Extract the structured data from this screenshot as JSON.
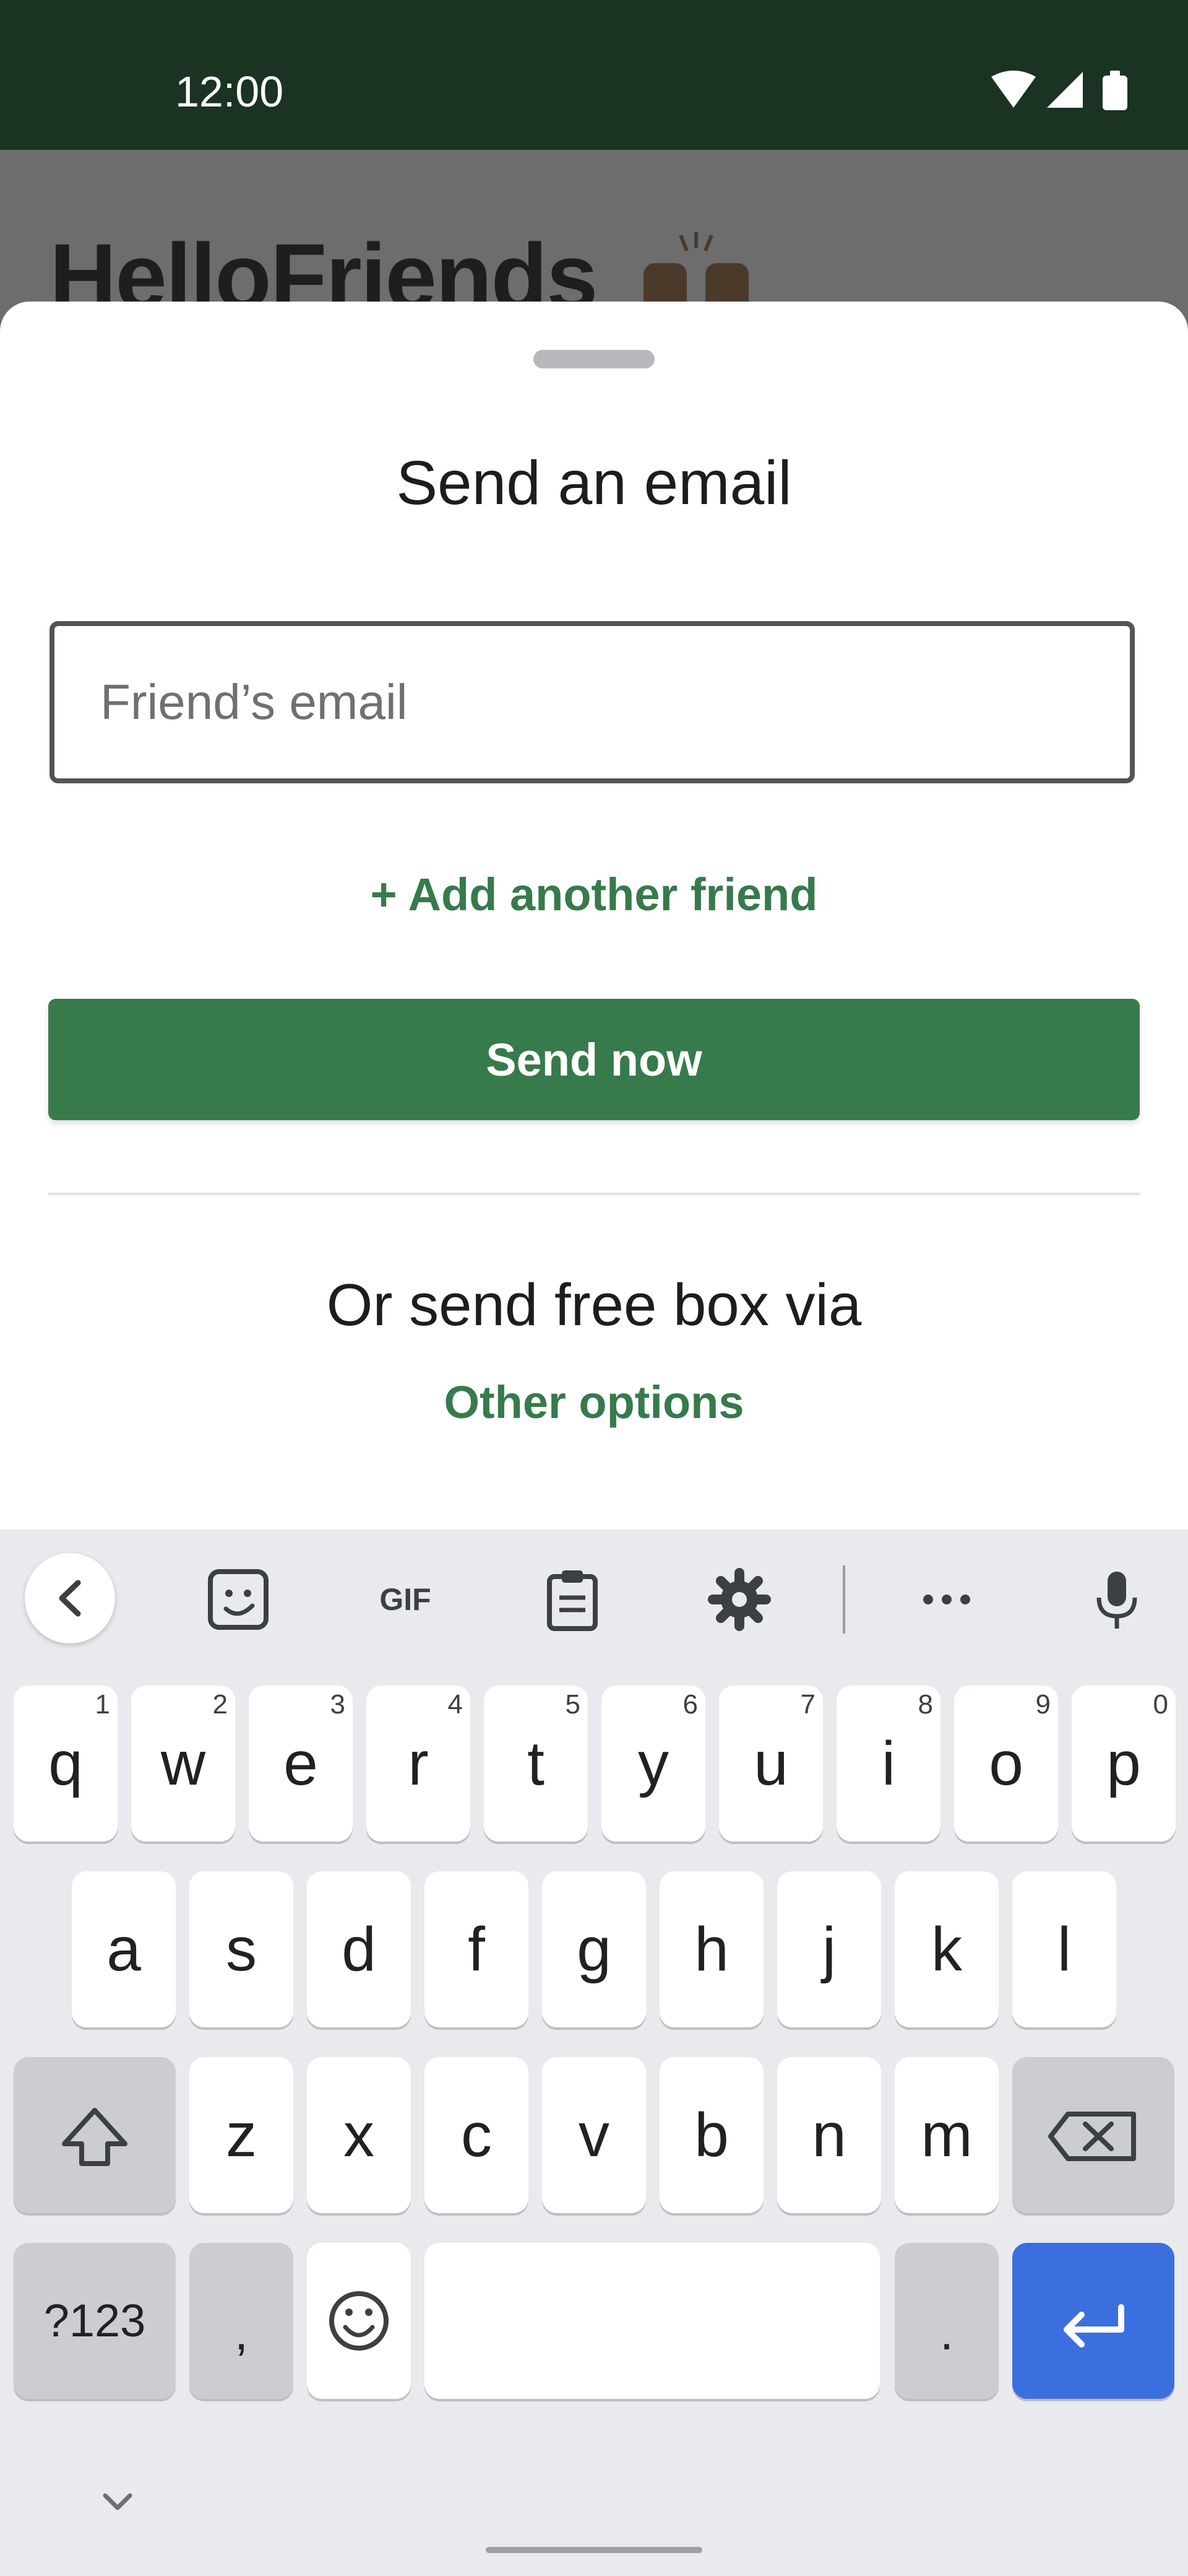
{
  "status_bar": {
    "time": "12:00"
  },
  "background_page": {
    "title": "HelloFriends"
  },
  "sheet": {
    "title": "Send an email",
    "email_placeholder": "Friend’s email",
    "add_link": "+ Add another friend",
    "send_button": "Send now",
    "alt_heading": "Or send free box via",
    "alt_link": "Other options"
  },
  "keyboard": {
    "toolbar_gif": "GIF",
    "row1": [
      {
        "k": "q",
        "n": "1"
      },
      {
        "k": "w",
        "n": "2"
      },
      {
        "k": "e",
        "n": "3"
      },
      {
        "k": "r",
        "n": "4"
      },
      {
        "k": "t",
        "n": "5"
      },
      {
        "k": "y",
        "n": "6"
      },
      {
        "k": "u",
        "n": "7"
      },
      {
        "k": "i",
        "n": "8"
      },
      {
        "k": "o",
        "n": "9"
      },
      {
        "k": "p",
        "n": "0"
      }
    ],
    "row2": [
      "a",
      "s",
      "d",
      "f",
      "g",
      "h",
      "j",
      "k",
      "l"
    ],
    "row3": [
      "z",
      "x",
      "c",
      "v",
      "b",
      "n",
      "m"
    ],
    "symbols_key": "?123",
    "comma_key": ",",
    "period_key": "."
  },
  "colors": {
    "accent_green": "#377a4c",
    "status_bar": "#1b3322",
    "enter_key": "#3b6fe0"
  },
  "icons": [
    "wifi-icon",
    "signal-icon",
    "battery-icon",
    "chevron-left-icon",
    "sticker-icon",
    "clipboard-icon",
    "gear-icon",
    "more-icon",
    "mic-icon",
    "shift-icon",
    "backspace-icon",
    "emoji-icon",
    "enter-icon",
    "chevron-down-icon"
  ]
}
